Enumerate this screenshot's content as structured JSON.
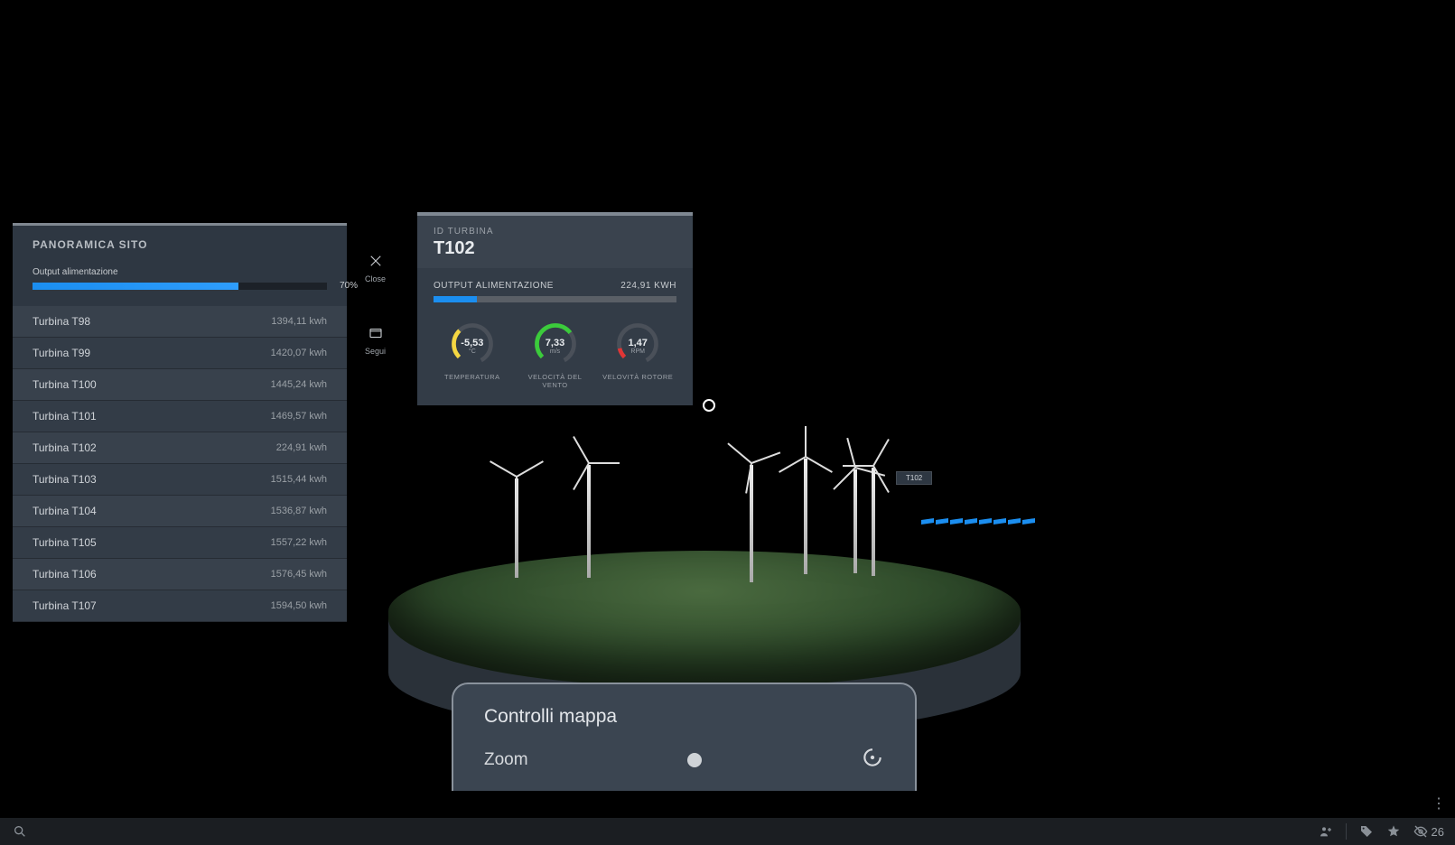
{
  "site_panel": {
    "title": "PANORAMICA SITO",
    "power_output_label": "Output alimentazione",
    "power_output_pct": 70,
    "power_output_pct_text": "70%"
  },
  "turbines": [
    {
      "name": "Turbina T98",
      "value": "1394,11 kwh"
    },
    {
      "name": "Turbina T99",
      "value": "1420,07 kwh"
    },
    {
      "name": "Turbina T100",
      "value": "1445,24 kwh"
    },
    {
      "name": "Turbina T101",
      "value": "1469,57 kwh"
    },
    {
      "name": "Turbina T102",
      "value": "224,91 kwh"
    },
    {
      "name": "Turbina T103",
      "value": "1515,44 kwh"
    },
    {
      "name": "Turbina T104",
      "value": "1536,87 kwh"
    },
    {
      "name": "Turbina T105",
      "value": "1557,22 kwh"
    },
    {
      "name": "Turbina T106",
      "value": "1576,45 kwh"
    },
    {
      "name": "Turbina T107",
      "value": "1594,50 kwh"
    }
  ],
  "side_actions": {
    "close": "Close",
    "follow": "Segui"
  },
  "detail": {
    "header_label": "ID TURBINA",
    "id": "T102",
    "output_label": "OUTPUT  ALIMENTAZIONE",
    "output_value": "224,91 KWH",
    "output_pct": 18,
    "gauges": {
      "temp": {
        "value": "-5,53",
        "unit": "°C",
        "label": "TEMPERATURA"
      },
      "wind": {
        "value": "7,33",
        "unit": "m/s",
        "label": "VELOCITÀ DEL VENTO"
      },
      "rotor": {
        "value": "1,47",
        "unit": "RPM",
        "label": "VELOVITÀ ROTORE"
      }
    }
  },
  "scene": {
    "selected_tag": "T102"
  },
  "map_controls": {
    "title": "Controlli mappa",
    "zoom_label": "Zoom"
  },
  "statusbar": {
    "count": "26"
  }
}
